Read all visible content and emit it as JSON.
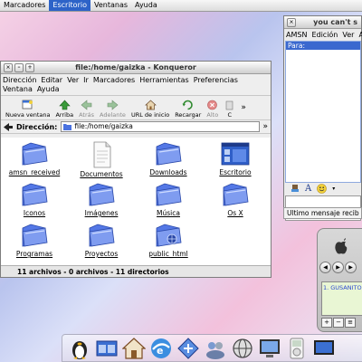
{
  "topbar": {
    "items": [
      "Marcadores",
      "Escritorio",
      "Ventanas",
      "Ayuda"
    ],
    "active_index": 1
  },
  "konqueror": {
    "title": "file:/home/gaizka - Konqueror",
    "menu_row1": [
      "Dirección",
      "Editar",
      "Ver",
      "Ir",
      "Marcadores",
      "Herramientas",
      "Preferencias"
    ],
    "menu_row2": [
      "Ventana",
      "Ayuda"
    ],
    "toolbar": [
      {
        "label": "Nueva ventana",
        "icon": "new-window-icon",
        "enabled": true
      },
      {
        "label": "Arriba",
        "icon": "up-arrow-icon",
        "enabled": true
      },
      {
        "label": "Atrás",
        "icon": "back-arrow-icon",
        "enabled": false
      },
      {
        "label": "Adelante",
        "icon": "forward-arrow-icon",
        "enabled": false
      },
      {
        "label": "URL de inicio",
        "icon": "home-icon",
        "enabled": true
      },
      {
        "label": "Recargar",
        "icon": "reload-icon",
        "enabled": true
      },
      {
        "label": "Alto",
        "icon": "stop-icon",
        "enabled": false
      },
      {
        "label": "C",
        "icon": "",
        "enabled": true
      }
    ],
    "overflow": "»",
    "address": {
      "label": "Dirección:",
      "value": "file:/home/gaizka"
    },
    "files": [
      {
        "name": "amsn_received",
        "kind": "folder"
      },
      {
        "name": "Documentos",
        "kind": "document"
      },
      {
        "name": "Downloads",
        "kind": "folder"
      },
      {
        "name": "Escritorio",
        "kind": "desktop"
      },
      {
        "name": "Iconos",
        "kind": "folder"
      },
      {
        "name": "Imágenes",
        "kind": "folder"
      },
      {
        "name": "Música",
        "kind": "folder"
      },
      {
        "name": "Os X",
        "kind": "folder"
      },
      {
        "name": "Programas",
        "kind": "folder"
      },
      {
        "name": "Proyectos",
        "kind": "folder"
      },
      {
        "name": "public_html",
        "kind": "web-folder"
      }
    ],
    "status": "11 archivos - 0 archivos - 11 directorios"
  },
  "amsn": {
    "title": "you can't s",
    "menu": [
      "AMSN",
      "Edición",
      "Ver",
      "Ac"
    ],
    "to_label": "Para:",
    "last_message": "Ultimo mensaje recib"
  },
  "player": {
    "playlist_item": "1. GUSANITO -"
  },
  "dock": {
    "icons": [
      "tux-icon",
      "window-list-icon",
      "home-icon",
      "browser-icon",
      "network-icon",
      "people-icon",
      "globe-icon",
      "monitor-icon",
      "ipod-icon",
      "screen-icon"
    ]
  },
  "colors": {
    "accent": "#2d63c8",
    "folder": "#4a72e0"
  }
}
